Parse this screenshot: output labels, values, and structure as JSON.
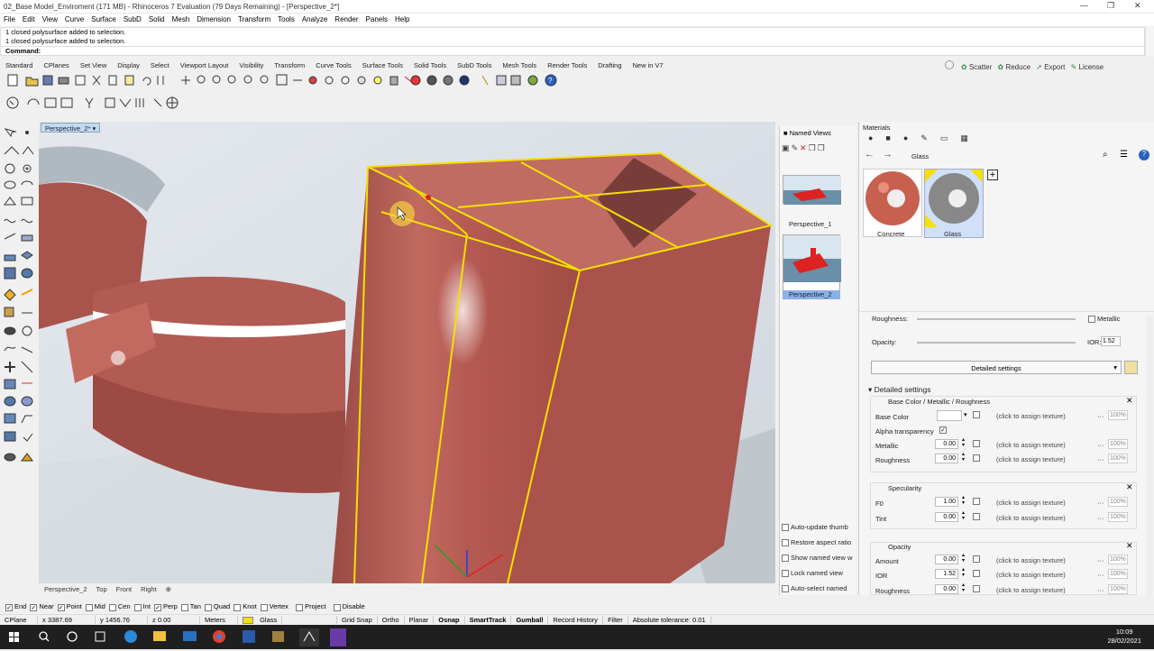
{
  "window": {
    "title": "02_Base Model_Enviroment (171 MB) - Rhinoceros 7 Evaluation (79 Days Remaining) - [Perspective_2*]"
  },
  "menu": [
    "File",
    "Edit",
    "View",
    "Curve",
    "Surface",
    "SubD",
    "Solid",
    "Mesh",
    "Dimension",
    "Transform",
    "Tools",
    "Analyze",
    "Render",
    "Panels",
    "Help"
  ],
  "history": [
    "1 closed polysurface added to selection.",
    "1 closed polysurface added to selection."
  ],
  "command_label": "Command:",
  "toolbar_tabs": [
    "Standard",
    "CPlanes",
    "Set View",
    "Display",
    "Select",
    "Viewport Layout",
    "Visibility",
    "Transform",
    "Curve Tools",
    "Surface Tools",
    "Solid Tools",
    "SubD Tools",
    "Mesh Tools",
    "Render Tools",
    "Drafting",
    "New in V7"
  ],
  "right_tools": [
    "Scatter",
    "Reduce",
    "Export",
    "License"
  ],
  "viewport": {
    "label": "Perspective_2*",
    "tabs": [
      "Perspective_2",
      "Top",
      "Front",
      "Right"
    ]
  },
  "named_views": {
    "title": "Named Views",
    "views": [
      "Perspective_1",
      "Perspective_2"
    ],
    "options": [
      "Auto-update thumb",
      "Restore aspect ratio",
      "Show named view w",
      "Lock named view",
      "Auto-select named"
    ]
  },
  "materials": {
    "title": "Materials",
    "breadcrumb": "Glass",
    "items": [
      "Concrete",
      "Glass"
    ],
    "roughness_label": "Roughness:",
    "metallic_label": "Metallic",
    "opacity_label": "Opacity:",
    "ior_label": "IOR:",
    "ior_value": "1.52",
    "detailed_dropdown": "Detailed settings",
    "detailed_header": "Detailed settings",
    "section_base": {
      "title": "Base Color /  Metallic / Roughness",
      "rows": [
        {
          "label": "Base Color",
          "value": "",
          "tex": "(click to assign texture)",
          "pct": "100%"
        },
        {
          "label": "Alpha transparency",
          "value": "",
          "tex": "",
          "pct": ""
        },
        {
          "label": "Metallic",
          "value": "0.00",
          "tex": "(click to assign texture)",
          "pct": "100%"
        },
        {
          "label": "Roughness",
          "value": "0.00",
          "tex": "(click to assign texture)",
          "pct": "100%"
        }
      ]
    },
    "section_spec": {
      "title": "Specularity",
      "rows": [
        {
          "label": "F0",
          "value": "1.00",
          "tex": "(click to assign texture)",
          "pct": "100%"
        },
        {
          "label": "Tint",
          "value": "0.00",
          "tex": "(click to assign texture)",
          "pct": "100%"
        }
      ]
    },
    "section_opacity": {
      "title": "Opacity",
      "rows": [
        {
          "label": "Amount",
          "value": "0.00",
          "tex": "(click to assign texture)",
          "pct": "100%"
        },
        {
          "label": "IOR",
          "value": "1.52",
          "tex": "(click to assign texture)",
          "pct": "100%"
        },
        {
          "label": "Roughness",
          "value": "0.00",
          "tex": "(click to assign texture)",
          "pct": "100%"
        }
      ]
    }
  },
  "osnap": [
    {
      "label": "End",
      "on": true
    },
    {
      "label": "Near",
      "on": true
    },
    {
      "label": "Point",
      "on": true
    },
    {
      "label": "Mid",
      "on": false
    },
    {
      "label": "Cen",
      "on": false
    },
    {
      "label": "Int",
      "on": false
    },
    {
      "label": "Perp",
      "on": true
    },
    {
      "label": "Tan",
      "on": false
    },
    {
      "label": "Quad",
      "on": false
    },
    {
      "label": "Knot",
      "on": false
    },
    {
      "label": "Vertex",
      "on": false
    },
    {
      "label": "Project",
      "on": false
    },
    {
      "label": "Disable",
      "on": false
    }
  ],
  "status": {
    "cplane": "CPlane",
    "x": "x 3387.69",
    "y": "y 1456.76",
    "z": "z 0.00",
    "units": "Meters",
    "layer": "Glass",
    "toggles": [
      "Grid Snap",
      "Ortho",
      "Planar",
      "Osnap",
      "SmartTrack",
      "Gumball",
      "Record History",
      "Filter"
    ],
    "tolerance": "Absolute tolerance: 0.01"
  },
  "clock": {
    "time": "10:09",
    "date": "28/02/2021"
  },
  "colors": {
    "accent": "#0078d7",
    "selection": "#f5e000",
    "material": "#b85a52"
  }
}
